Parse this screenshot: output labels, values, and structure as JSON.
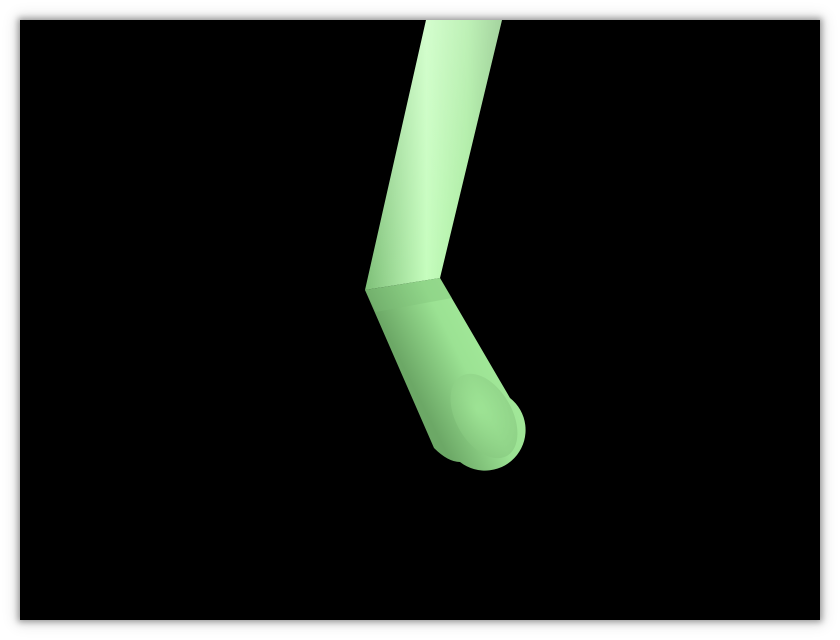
{
  "scene": {
    "background_color": "#000000",
    "object": {
      "kind": "bent-cylinder",
      "color": "#a6f0a0",
      "highlight_color": "#d4ffce",
      "shadow_color": "#6aa865"
    }
  }
}
